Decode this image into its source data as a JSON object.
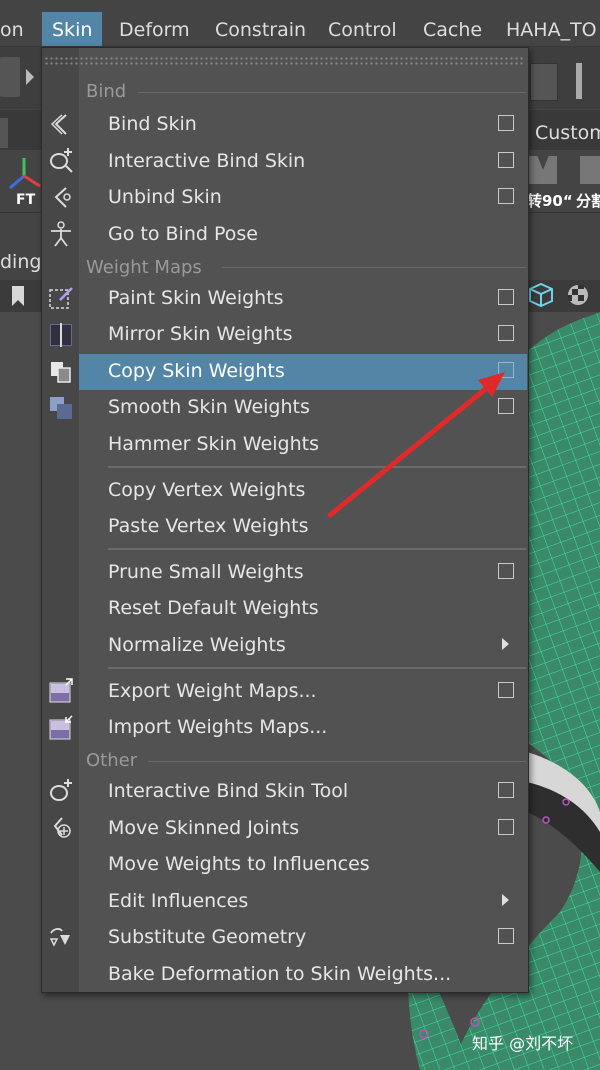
{
  "menubar": {
    "items": [
      "on",
      "Skin",
      "Deform",
      "Constrain",
      "Control",
      "Cache",
      "HAHA_TO"
    ]
  },
  "background": {
    "custom_tab": "Custom",
    "ft_label": "FT",
    "shelf_text_1": "转90“",
    "shelf_text_2": "分割",
    "left_text": "ding"
  },
  "menu": {
    "sections": {
      "bind": "Bind",
      "weight_maps": "Weight Maps",
      "other": "Other"
    },
    "items": [
      {
        "label": "Bind Skin",
        "option_box": true
      },
      {
        "label": "Interactive Bind Skin",
        "option_box": true
      },
      {
        "label": "Unbind Skin",
        "option_box": true
      },
      {
        "label": "Go to Bind Pose",
        "option_box": false
      },
      {
        "label": "Paint Skin Weights",
        "option_box": true
      },
      {
        "label": "Mirror Skin Weights",
        "option_box": true
      },
      {
        "label": "Copy Skin Weights",
        "option_box": true,
        "highlighted": true
      },
      {
        "label": "Smooth Skin Weights",
        "option_box": true
      },
      {
        "label": "Hammer Skin Weights",
        "option_box": false
      },
      {
        "label": "Copy Vertex Weights",
        "option_box": false
      },
      {
        "label": "Paste Vertex Weights",
        "option_box": false
      },
      {
        "label": "Prune Small Weights",
        "option_box": true
      },
      {
        "label": "Reset Default Weights",
        "option_box": false
      },
      {
        "label": "Normalize Weights",
        "submenu": true
      },
      {
        "label": "Export Weight Maps...",
        "option_box": true
      },
      {
        "label": "Import Weights Maps...",
        "option_box": false
      },
      {
        "label": "Interactive Bind Skin Tool",
        "option_box": true
      },
      {
        "label": "Move Skinned Joints",
        "option_box": true
      },
      {
        "label": "Move Weights to Influences",
        "option_box": false
      },
      {
        "label": "Edit Influences",
        "submenu": true
      },
      {
        "label": "Substitute Geometry",
        "option_box": true
      },
      {
        "label": "Bake Deformation to Skin Weights...",
        "option_box": false
      }
    ]
  },
  "watermark": "知乎 @刘不坏",
  "colors": {
    "highlight": "#5285a6",
    "annotation_arrow": "#e02a2a",
    "mesh": "#3fe0a0"
  }
}
